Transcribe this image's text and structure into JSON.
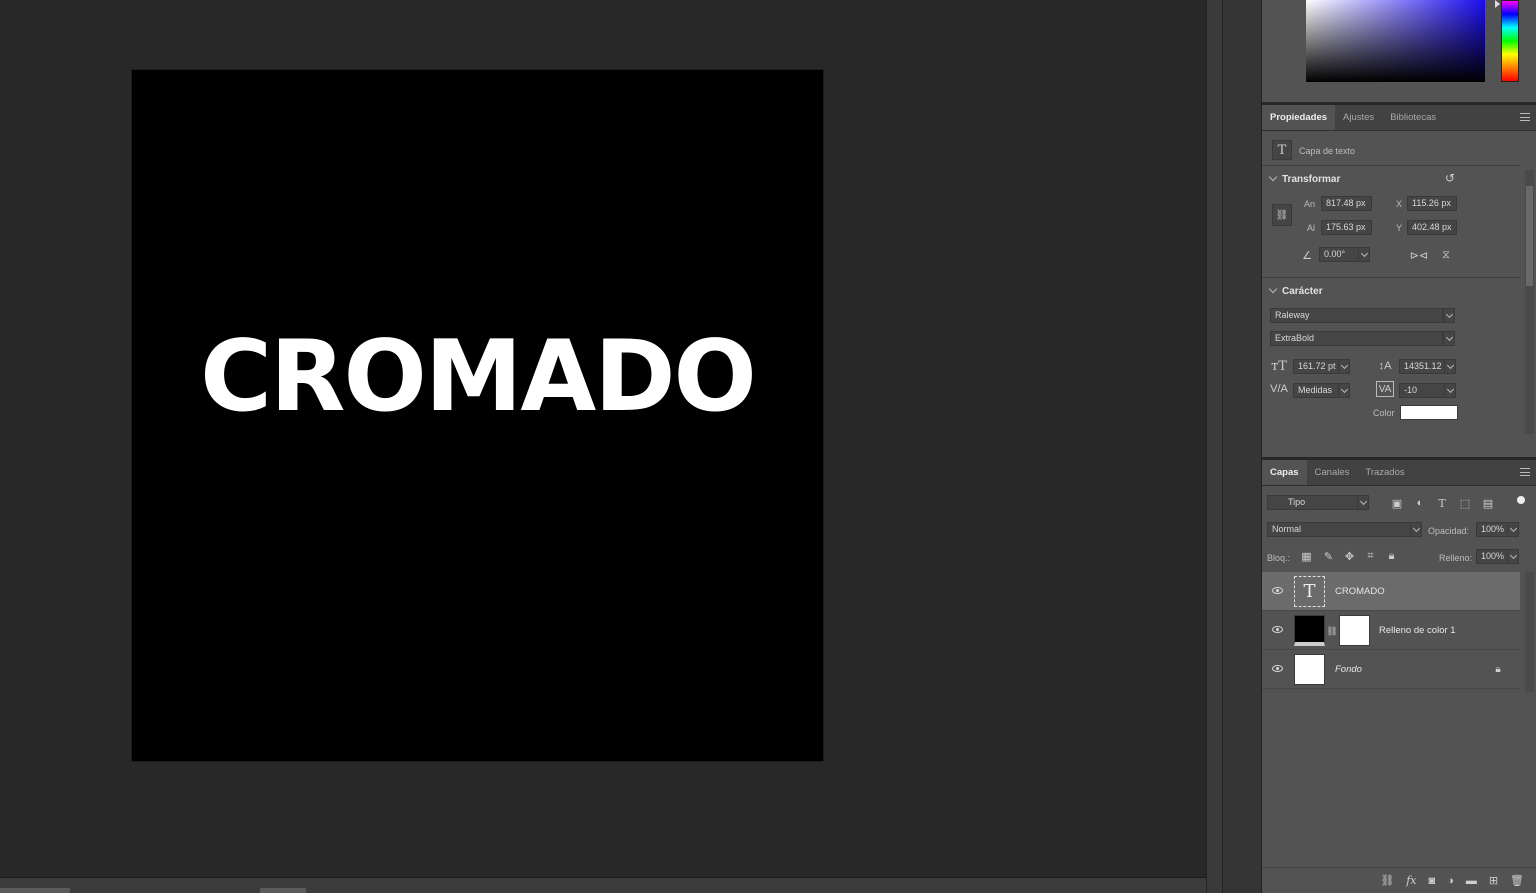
{
  "canvas": {
    "text": "CROMADO",
    "background": "#000000",
    "text_color": "#ffffff"
  },
  "properties": {
    "tabs": [
      "Propiedades",
      "Ajustes",
      "Bibliotecas"
    ],
    "layer_type": "Capa de texto",
    "transform": {
      "title": "Transformar",
      "width_label": "An",
      "width": "817.48 px",
      "height_label": "Al",
      "height": "175.63 px",
      "x_label": "X",
      "x": "115.26 px",
      "y_label": "Y",
      "y": "402.48 px",
      "angle": "0.00°"
    },
    "character": {
      "title": "Carácter",
      "font_family": "Raleway",
      "font_style": "ExtraBold",
      "size": "161.72 pt",
      "leading": "14351.12",
      "kerning": "Medidas",
      "tracking": "-10",
      "color_label": "Color",
      "color": "#ffffff"
    }
  },
  "layers_panel": {
    "tabs": [
      "Capas",
      "Canales",
      "Trazados"
    ],
    "filter": "Tipo",
    "blend_mode": "Normal",
    "opacity_label": "Opacidad:",
    "opacity": "100%",
    "lock_label": "Bloq.:",
    "fill_label": "Relleno:",
    "fill": "100%",
    "layers": [
      {
        "name": "CROMADO",
        "type": "text",
        "selected": true
      },
      {
        "name": "Relleno de color 1",
        "type": "fill"
      },
      {
        "name": "Fondo",
        "type": "background",
        "locked": true
      }
    ],
    "footer_icons": [
      "link-icon",
      "fx-icon",
      "mask-icon",
      "adjustment-icon",
      "folder-icon",
      "new-layer-icon",
      "trash-icon"
    ]
  }
}
